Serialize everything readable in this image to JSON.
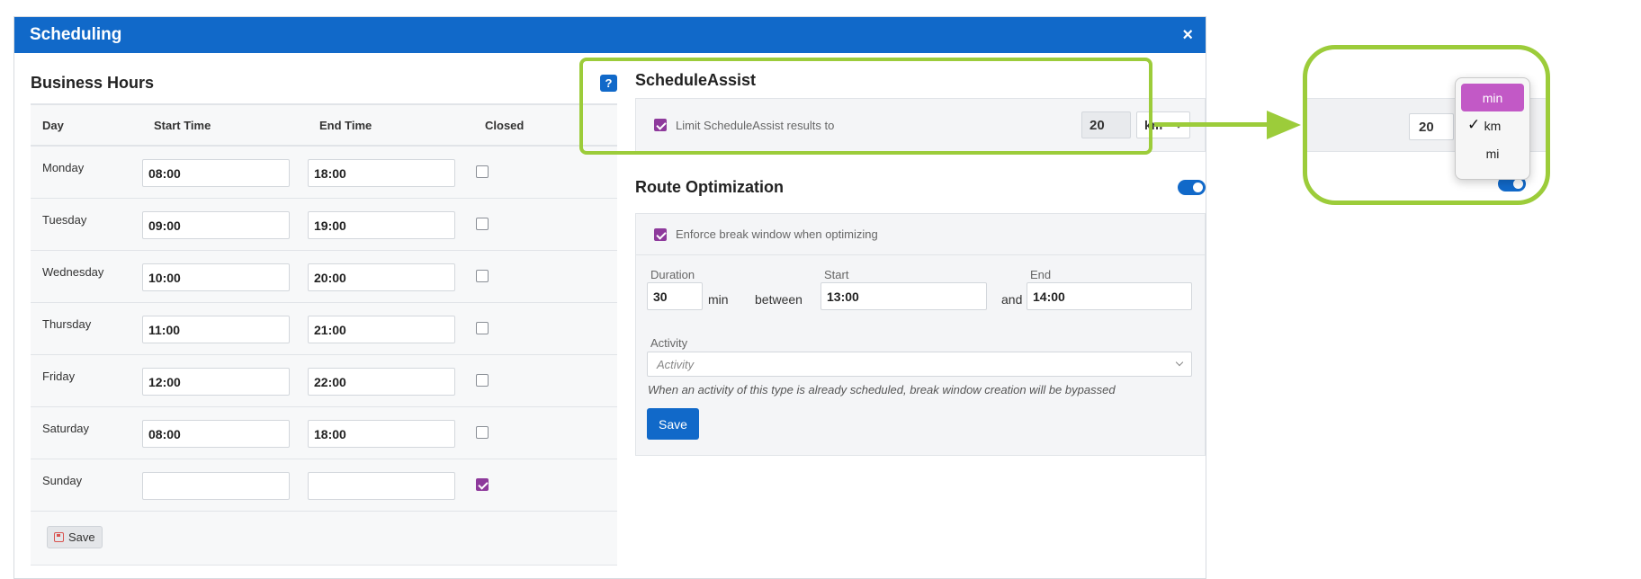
{
  "dialog": {
    "title": "Scheduling",
    "close_icon": "×"
  },
  "business_hours": {
    "title": "Business Hours",
    "help_label": "?",
    "columns": [
      "Day",
      "Start Time",
      "End Time",
      "Closed"
    ],
    "rows": [
      {
        "day": "Monday",
        "start": "08:00",
        "end": "18:00",
        "closed": false
      },
      {
        "day": "Tuesday",
        "start": "09:00",
        "end": "19:00",
        "closed": false
      },
      {
        "day": "Wednesday",
        "start": "10:00",
        "end": "20:00",
        "closed": false
      },
      {
        "day": "Thursday",
        "start": "11:00",
        "end": "21:00",
        "closed": false
      },
      {
        "day": "Friday",
        "start": "12:00",
        "end": "22:00",
        "closed": false
      },
      {
        "day": "Saturday",
        "start": "08:00",
        "end": "18:00",
        "closed": false
      },
      {
        "day": "Sunday",
        "start": "",
        "end": "",
        "closed": true
      }
    ],
    "save_label": "Save"
  },
  "schedule_assist": {
    "title": "ScheduleAssist",
    "limit_label": "Limit ScheduleAssist results to",
    "limit_checked": true,
    "limit_value": "20",
    "unit_value": "km"
  },
  "route_optimization": {
    "title": "Route Optimization",
    "enabled": true,
    "enforce_label": "Enforce break window when optimizing",
    "enforce_checked": true,
    "duration_label": "Duration",
    "duration_value": "30",
    "duration_unit": "min",
    "between_label": "between",
    "start_label": "Start",
    "start_value": "13:00",
    "and_label": "and",
    "end_label": "End",
    "end_value": "14:00",
    "activity_label": "Activity",
    "activity_placeholder": "Activity",
    "hint": "When an activity of this type is already scheduled, break window creation will be bypassed",
    "save_label": "Save"
  },
  "callout": {
    "value": "20",
    "dropdown_options": [
      "min",
      "km",
      "mi"
    ],
    "highlighted_option": "min",
    "checked_option": "km",
    "check_mark": "✓"
  },
  "colors": {
    "header_blue": "#1169c9",
    "checkbox_purple": "#8e3a9c",
    "highlight_green": "#9ccc3a",
    "dropdown_selected": "#c259c6"
  }
}
